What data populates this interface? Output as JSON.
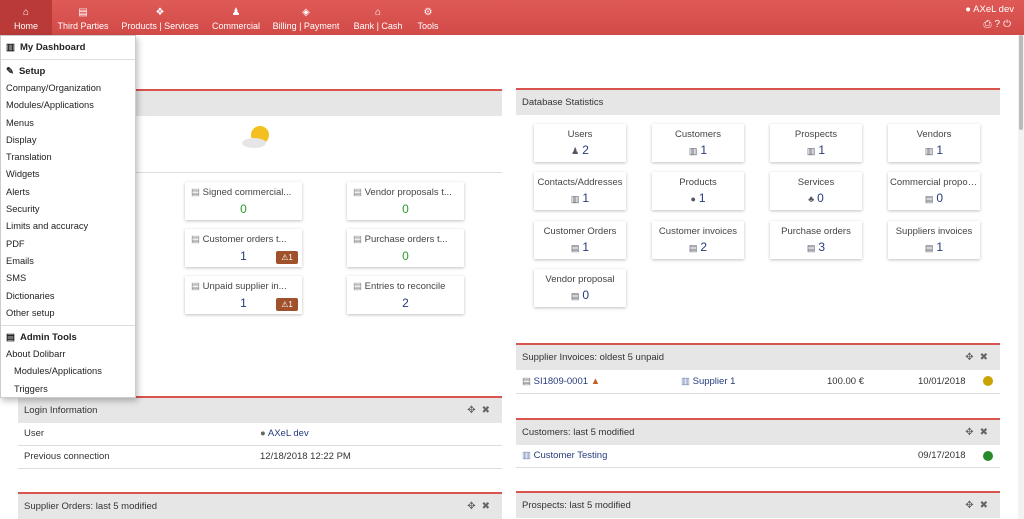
{
  "nav": [
    {
      "label": "Home",
      "icon": "home-icon",
      "glyph": "⌂"
    },
    {
      "label": "Third Parties",
      "icon": "building-icon",
      "glyph": "▤"
    },
    {
      "label": "Products | Services",
      "icon": "cubes-icon",
      "glyph": "❖"
    },
    {
      "label": "Commercial",
      "icon": "person-icon",
      "glyph": "♟"
    },
    {
      "label": "Billing | Payment",
      "icon": "diamond-icon",
      "glyph": "◈"
    },
    {
      "label": "Bank | Cash",
      "icon": "bank-icon",
      "glyph": "⌂"
    },
    {
      "label": "Tools",
      "icon": "cogs-icon",
      "glyph": "⚙"
    }
  ],
  "user": {
    "name": "AXeL dev"
  },
  "menu": {
    "dashboard": "My Dashboard",
    "setup": "Setup",
    "setup_items": [
      "Company/Organization",
      "Modules/Applications",
      "Menus",
      "Display",
      "Translation",
      "Widgets",
      "Alerts",
      "Security",
      "Limits and accuracy",
      "PDF",
      "Emails",
      "SMS",
      "Dictionaries",
      "Other setup"
    ],
    "admin": "Admin Tools",
    "about": "About Dolibarr",
    "admin_sub": [
      "Modules/Applications",
      "Triggers"
    ]
  },
  "workboard": [
    {
      "title": "Signed commercial...",
      "value": "0",
      "color": "green",
      "warn": ""
    },
    {
      "title": "Vendor proposals t...",
      "value": "0",
      "color": "green",
      "warn": ""
    },
    {
      "title": "Customer orders t...",
      "value": "1",
      "color": "blue",
      "warn": "⚠1"
    },
    {
      "title": "Purchase orders t...",
      "value": "0",
      "color": "green",
      "warn": ""
    },
    {
      "title": "Unpaid supplier in...",
      "value": "1",
      "color": "blue",
      "warn": "⚠1"
    },
    {
      "title": "Entries to reconcile",
      "value": "2",
      "color": "blue",
      "warn": ""
    }
  ],
  "stats": {
    "title": "Database Statistics",
    "cards": [
      {
        "label": "Users",
        "value": "2"
      },
      {
        "label": "Customers",
        "value": "1"
      },
      {
        "label": "Prospects",
        "value": "1"
      },
      {
        "label": "Vendors",
        "value": "1"
      },
      {
        "label": "Contacts/Addresses",
        "value": "1"
      },
      {
        "label": "Products",
        "value": "1"
      },
      {
        "label": "Services",
        "value": "0"
      },
      {
        "label": "Commercial proposals",
        "value": "0"
      },
      {
        "label": "Customer Orders",
        "value": "1"
      },
      {
        "label": "Customer invoices",
        "value": "2"
      },
      {
        "label": "Purchase orders",
        "value": "3"
      },
      {
        "label": "Suppliers invoices",
        "value": "1"
      },
      {
        "label": "Vendor proposal",
        "value": "0"
      }
    ]
  },
  "supplier_invoices": {
    "title": "Supplier Invoices: oldest 5 unpaid",
    "ref": "SI1809-0001",
    "supplier": "Supplier 1",
    "amount": "100.00 €",
    "date": "10/01/2018",
    "status_color": "#c9a400"
  },
  "customers": {
    "title": "Customers: last 5 modified",
    "name": "Customer Testing",
    "date": "09/17/2018",
    "status_color": "#2a8a2a"
  },
  "prospects": {
    "title": "Prospects: last 5 modified"
  },
  "login": {
    "title": "Login Information",
    "user_label": "User",
    "user_value": "AXeL dev",
    "prev_label": "Previous connection",
    "prev_value": "12/18/2018 12:22 PM"
  },
  "supplier_orders": {
    "title": "Supplier Orders: last 5 modified"
  }
}
